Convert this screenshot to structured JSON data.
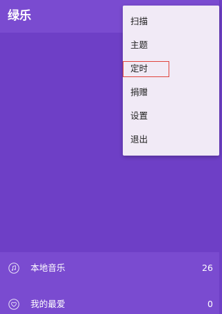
{
  "app": {
    "title": "绿乐"
  },
  "menu": {
    "items": [
      {
        "label": "扫描"
      },
      {
        "label": "主题"
      },
      {
        "label": "定时"
      },
      {
        "label": "捐赠"
      },
      {
        "label": "设置"
      },
      {
        "label": "退出"
      }
    ]
  },
  "library": {
    "items": [
      {
        "label": "本地音乐",
        "count": "26",
        "icon": "music-note-icon"
      },
      {
        "label": "我的最爱",
        "count": "0",
        "icon": "heart-icon"
      }
    ]
  },
  "colors": {
    "background": "#6e3fc6",
    "app_bar": "#7a4bd0",
    "menu_background": "#f1eaf6",
    "highlight": "#e0443c"
  }
}
